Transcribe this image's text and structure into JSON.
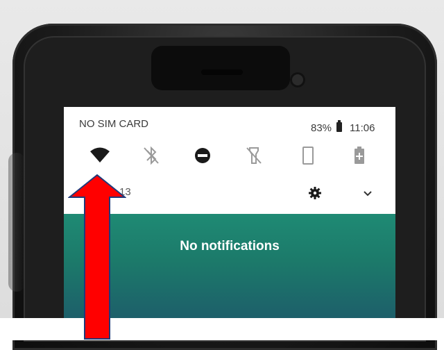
{
  "status_bar": {
    "carrier": "NO SIM CARD",
    "battery_percent": "83%",
    "time": "11:06"
  },
  "quick_settings": [
    {
      "name": "wifi",
      "icon": "wifi-icon",
      "active": true
    },
    {
      "name": "bluetooth",
      "icon": "bluetooth-off-icon",
      "active": false
    },
    {
      "name": "do-not-disturb",
      "icon": "do-not-disturb-icon",
      "active": true
    },
    {
      "name": "flashlight",
      "icon": "flashlight-off-icon",
      "active": false
    },
    {
      "name": "auto-rotate",
      "icon": "portrait-rotate-icon",
      "active": false
    },
    {
      "name": "battery-saver",
      "icon": "battery-saver-icon",
      "active": false
    }
  ],
  "date_row": {
    "date_text": "13",
    "settings_icon": "gear-icon",
    "expand_icon": "chevron-down-icon"
  },
  "notifications": {
    "empty_text": "No notifications"
  },
  "annotation": {
    "arrow_color": "#ff0000",
    "arrow_outline": "#1f3a7a",
    "target": "wifi"
  }
}
